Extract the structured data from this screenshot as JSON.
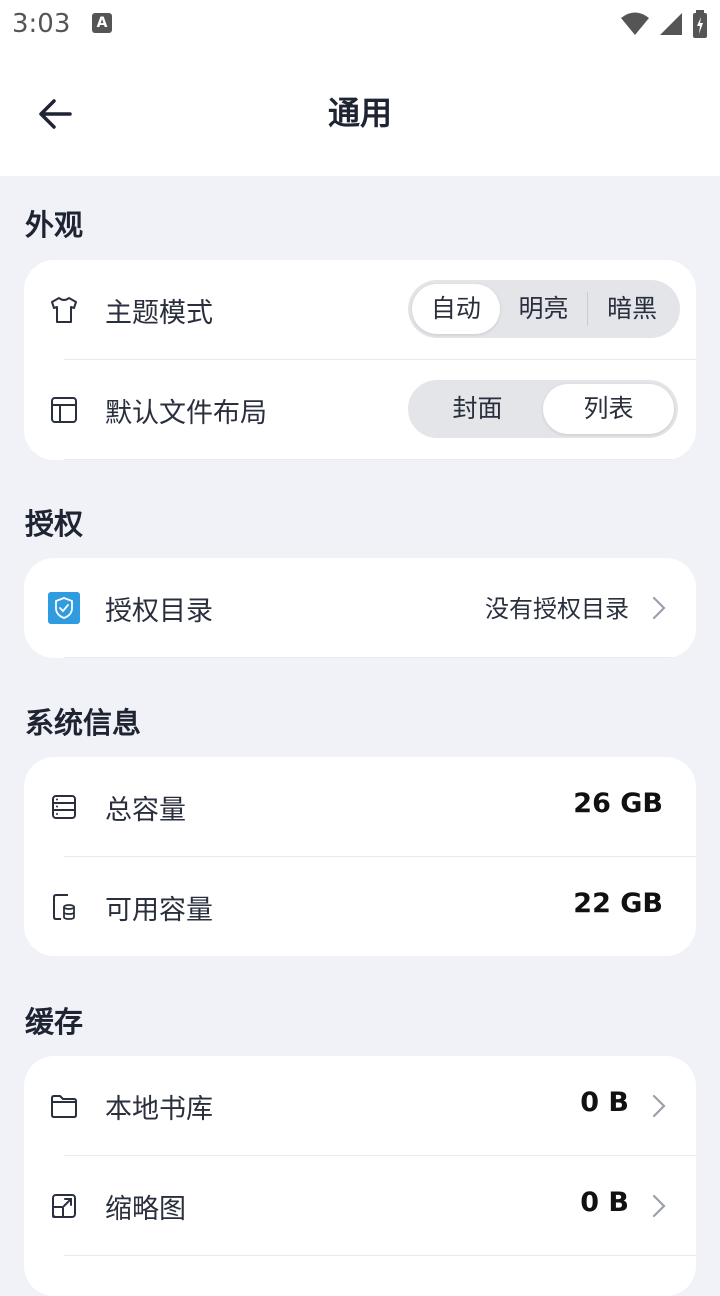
{
  "status_bar": {
    "time": "3:03"
  },
  "app_bar": {
    "title": "通用"
  },
  "sections": {
    "appearance": {
      "title": "外观",
      "theme": {
        "label": "主题模式",
        "options": [
          "自动",
          "明亮",
          "暗黑"
        ],
        "selected": "自动"
      },
      "layout": {
        "label": "默认文件布局",
        "options": [
          "封面",
          "列表"
        ],
        "selected": "列表"
      }
    },
    "authorization": {
      "title": "授权",
      "auth_dir": {
        "label": "授权目录",
        "value": "没有授权目录"
      }
    },
    "system_info": {
      "title": "系统信息",
      "total": {
        "label": "总容量",
        "value": "26 GB"
      },
      "available": {
        "label": "可用容量",
        "value": "22 GB"
      }
    },
    "cache": {
      "title": "缓存",
      "local_library": {
        "label": "本地书库",
        "value": "0 B"
      },
      "thumbnails": {
        "label": "缩略图",
        "value": "0 B"
      }
    }
  },
  "colors": {
    "accent": "#2f9be0",
    "background": "#f0f2f7",
    "card": "#ffffff"
  }
}
